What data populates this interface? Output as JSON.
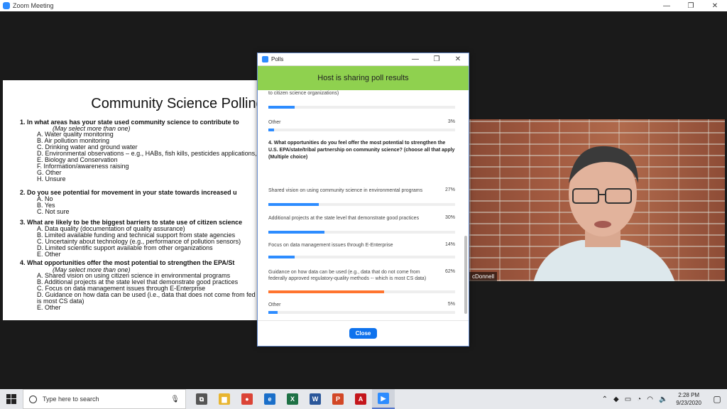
{
  "window": {
    "title": "Zoom Meeting",
    "min": "—",
    "max": "❐",
    "close": "✕"
  },
  "slide": {
    "title": "Community Science Polling",
    "q1": "1.  In what areas has your state used community science to contribute to",
    "q1_note": "(May select more than one)",
    "q1_opts": [
      "A. Water quality monitoring",
      "B. Air pollution monitoring",
      "C. Drinking water and ground water",
      "D. Environmental observations – e.g., HABs, fish kills, pesticides applications,",
      "E. Biology and Conservation",
      "F. Information/awareness raising",
      "G. Other",
      "H. Unsure"
    ],
    "q2": "2. Do you see potential for movement in your state towards increased u",
    "q2_opts": [
      "A. No",
      "B. Yes",
      "C. Not sure"
    ],
    "q3": "3. What are likely to be the biggest barriers to state use of citizen science",
    "q3_opts": [
      "A. Data quality (documentation of quality assurance)",
      "B. Limited available funding and technical support from state agencies",
      "C. Uncertainty about technology (e.g., performance of pollution sensors)",
      "D. Limited scientific support available from other organizations",
      "E. Other"
    ],
    "q4": "4. What opportunities offer the most potential to strengthen the EPA/St",
    "q4_note": "(May select more than one)",
    "q4_opts": [
      "A. Shared vision on using citizen science in environmental programs",
      "B. Additional projects at the state level that demonstrate good practices",
      "C. Focus on data management issues through E-Enterprise",
      "D. Guidance on how data can be used (i.e., data that does not come from fed",
      "    is most CS data)",
      "E. Other"
    ]
  },
  "video": {
    "name_tag": "cDonnell"
  },
  "poll": {
    "title": "Polls",
    "banner": "Host is sharing poll results",
    "top_cut_label": "to citizen science organizations)",
    "prev_bar_fill": 0.14,
    "prev_other": {
      "label": "Other",
      "pct": "3%",
      "fill": 0.03
    },
    "question": "4. What opportunities do you feel offer the most potential to strengthen the U.S. EPA/state/tribal partnership on community science? (choose all that apply (Multiple choice)",
    "answers": [
      {
        "label": "Shared vision on using community science in environmental programs",
        "pct": "27%",
        "fill": 0.27,
        "top": false
      },
      {
        "label": "Additional projects at the state level that demonstrate good practices",
        "pct": "30%",
        "fill": 0.3,
        "top": false
      },
      {
        "label": "Focus on data management issues through E-Enterprise",
        "pct": "14%",
        "fill": 0.14,
        "top": false
      },
      {
        "label": "Guidance on how data can be used (e.g., data that do not come from federally approved regulatory-quality methods -- which is most CS data)",
        "pct": "62%",
        "fill": 0.62,
        "top": true
      },
      {
        "label": "Other",
        "pct": "5%",
        "fill": 0.05,
        "top": false
      }
    ],
    "close_label": "Close"
  },
  "taskbar": {
    "search_placeholder": "Type here to search",
    "time": "2:28 PM",
    "date": "9/23/2020",
    "apps": [
      {
        "name": "task-view-icon",
        "glyph": "⧉",
        "color": "#555"
      },
      {
        "name": "file-explorer-icon",
        "glyph": "▆",
        "color": "#e8b530"
      },
      {
        "name": "chrome-icon",
        "glyph": "●",
        "color": "#db4437"
      },
      {
        "name": "edge-icon",
        "glyph": "e",
        "color": "#1b6fc9"
      },
      {
        "name": "excel-icon",
        "glyph": "X",
        "color": "#1e7145"
      },
      {
        "name": "word-icon",
        "glyph": "W",
        "color": "#2b579a"
      },
      {
        "name": "powerpoint-icon",
        "glyph": "P",
        "color": "#d24726"
      },
      {
        "name": "acrobat-icon",
        "glyph": "A",
        "color": "#c4161c"
      },
      {
        "name": "zoom-icon",
        "glyph": "▶",
        "color": "#2d8cff"
      }
    ]
  }
}
